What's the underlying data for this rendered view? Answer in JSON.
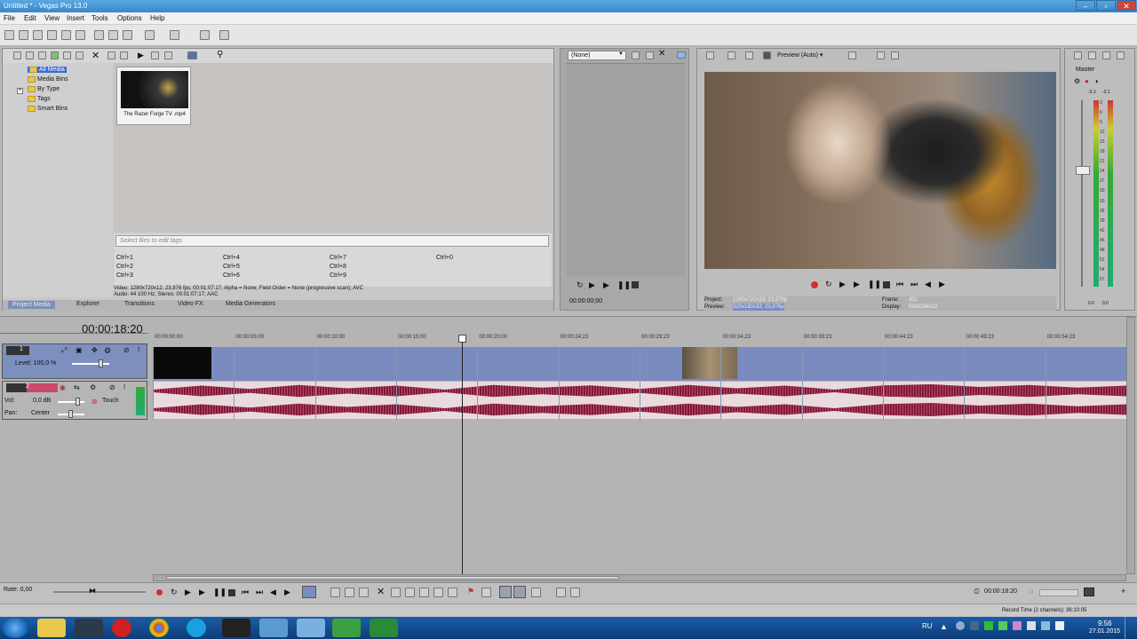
{
  "window": {
    "title": "Untitled * - Vegas Pro 13.0"
  },
  "menu": [
    "File",
    "Edit",
    "View",
    "Insert",
    "Tools",
    "Options",
    "Help"
  ],
  "media_tree": [
    "All Media",
    "Media Bins",
    "By Type",
    "Tags",
    "Smart Bins"
  ],
  "media_file": {
    "name": "The Razer Forge TV .mp4"
  },
  "tags": {
    "placeholder": "Select files to edit tags",
    "shortcuts": [
      "Ctrl+1",
      "Ctrl+2",
      "Ctrl+3",
      "Ctrl+4",
      "Ctrl+5",
      "Ctrl+6",
      "Ctrl+7",
      "Ctrl+8",
      "Ctrl+9",
      "Ctrl+0"
    ]
  },
  "media_info": {
    "video": "Video: 1280x720x12; 23,976 fps; 00:01:07:17; Alpha = None; Field Order = None (progressive scan); AVC",
    "audio": "Audio: 44 100 Hz; Stereo; 00:01:07:17; AAC"
  },
  "bottom_tabs": [
    "Project Media",
    "Explorer",
    "Transitions",
    "Video FX",
    "Media Generators"
  ],
  "trimmer": {
    "dropdown": "(None)",
    "time": "00:00:00;00"
  },
  "preview": {
    "mode": "Preview (Auto)",
    "project_label": "Project:",
    "project_value": "1280x720x32; 23,976p",
    "preview_label": "Preview:",
    "preview_value": "320x180x32; 23,976p",
    "frame_label": "Frame:",
    "frame_value": "452",
    "display_label": "Display:",
    "display_value": "593x334x32"
  },
  "master": {
    "label": "Master",
    "top_values": [
      "-3.1",
      "-3.1"
    ],
    "scale": [
      "3",
      "6",
      "9",
      "12",
      "15",
      "18",
      "21",
      "24",
      "27",
      "30",
      "33",
      "36",
      "39",
      "42",
      "45",
      "48",
      "51",
      "54",
      "57"
    ],
    "bottom_values": [
      "0.0",
      "0.0"
    ]
  },
  "timeline": {
    "current_time": "00:00:18:20",
    "ticks": [
      "00:00:00:00",
      "00:00:05:00",
      "00:00:10:00",
      "00:00:15:00",
      "00:00:20:00",
      "00:00:24:23",
      "00:00:29:23",
      "00:00:34:23",
      "00:00:39:23",
      "00:00:44:23",
      "00:00:49:23",
      "00:00:54:23"
    ],
    "video_track": {
      "number": "1",
      "level": "Level: 100,0 %"
    },
    "audio_track": {
      "number": "2",
      "vol": "Vol:",
      "vol_value": "0,0 dB",
      "pan": "Pan:",
      "pan_value": "Center",
      "mode": "Touch"
    }
  },
  "transport": {
    "rate": "Rate: 0,00",
    "time": "00:00:18:20"
  },
  "status": {
    "record_time": "Record Time (2 channels): 36:10:05"
  },
  "taskbar": {
    "lang": "RU",
    "time": "9:56",
    "date": "27.01.2015"
  },
  "colors": {
    "video_track": "#7a8bc0",
    "audio_wave": "#8a1e3a",
    "title_bar": "#3a86c8",
    "taskbar": "#0d3c78"
  }
}
